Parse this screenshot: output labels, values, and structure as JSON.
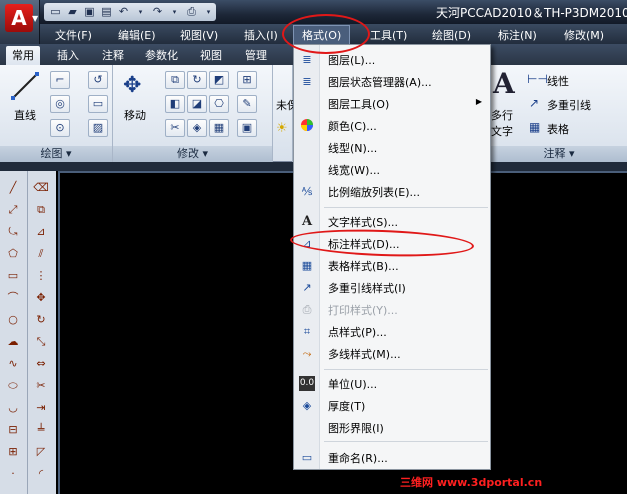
{
  "window": {
    "app_button": "A",
    "title": "天河PCCAD2010＆TH-P3DM2010-"
  },
  "quick_access": {
    "icons": [
      "new-file-icon",
      "open-folder-icon",
      "save-icon",
      "print-preview-icon",
      "undo-icon",
      "redo-icon",
      "plot-icon",
      "dropdown-arrow-icon"
    ]
  },
  "menubar": {
    "items": [
      "文件(F)",
      "编辑(E)",
      "视图(V)",
      "插入(I)",
      "格式(O)",
      "工具(T)",
      "绘图(D)",
      "标注(N)",
      "修改(M)"
    ],
    "active": "格式(O)"
  },
  "ribbon": {
    "tabs": [
      "常用",
      "插入",
      "注释",
      "参数化",
      "视图",
      "管理"
    ],
    "active_tab": "常用",
    "panels": {
      "draw": {
        "footer": "绘图 ▾",
        "line_label": "直线"
      },
      "modify": {
        "footer": "修改 ▾",
        "move_label": "移动"
      },
      "layer_partial": "未保",
      "annotation": {
        "footer": "注释 ▾",
        "multiline_text": "多行",
        "multiline_text2": "文字",
        "linear": "线性",
        "multileader": "多重引线",
        "table": "表格"
      }
    }
  },
  "format_menu": {
    "items": [
      {
        "label": "图层(L)...",
        "icon": "layer-icon",
        "group": 1
      },
      {
        "label": "图层状态管理器(A)...",
        "icon": "layer-states-icon",
        "group": 1
      },
      {
        "label": "图层工具(O)",
        "icon": "",
        "group": 1,
        "submenu": true
      },
      {
        "label": "颜色(C)...",
        "icon": "color-wheel-icon",
        "group": 1
      },
      {
        "label": "线型(N)...",
        "icon": "",
        "group": 1
      },
      {
        "label": "线宽(W)...",
        "icon": "",
        "group": 1
      },
      {
        "label": "比例缩放列表(E)...",
        "icon": "scale-list-icon",
        "group": 1
      },
      {
        "label": "文字样式(S)...",
        "icon": "text-style-icon",
        "group": 2
      },
      {
        "label": "标注样式(D)...",
        "icon": "dimension-style-icon",
        "group": 2
      },
      {
        "label": "表格样式(B)...",
        "icon": "table-style-icon",
        "group": 2
      },
      {
        "label": "多重引线样式(I)",
        "icon": "multileader-style-icon",
        "group": 2
      },
      {
        "label": "打印样式(Y)...",
        "icon": "plot-style-icon",
        "group": 2,
        "disabled": true
      },
      {
        "label": "点样式(P)...",
        "icon": "point-style-icon",
        "group": 2
      },
      {
        "label": "多线样式(M)...",
        "icon": "multiline-style-icon",
        "group": 2
      },
      {
        "label": "单位(U)...",
        "icon": "units-icon",
        "group": 3
      },
      {
        "label": "厚度(T)",
        "icon": "thickness-icon",
        "group": 3
      },
      {
        "label": "图形界限(I)",
        "icon": "",
        "group": 3
      },
      {
        "label": "重命名(R)...",
        "icon": "rename-icon",
        "group": 4
      }
    ]
  },
  "watermark": "三维网 www.3dportal.cn",
  "colors": {
    "annotation_red": "#e01818",
    "canvas": "#000000",
    "menu_bg": "#f5f6f7"
  }
}
